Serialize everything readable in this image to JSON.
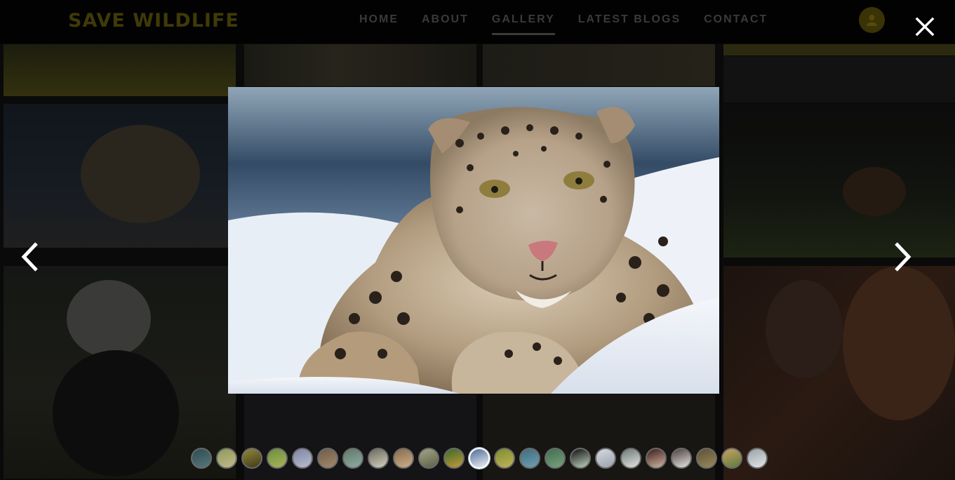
{
  "site": {
    "brand": "SAVE WILDLIFE",
    "nav": [
      "HOME",
      "ABOUT",
      "GALLERY",
      "LATEST BLOGS",
      "CONTACT"
    ],
    "active_nav": "GALLERY",
    "user_icon": "user-icon"
  },
  "lightbox": {
    "close_icon": "close-icon",
    "prev_icon": "chevron-left-icon",
    "next_icon": "chevron-right-icon",
    "image_subject": "snow leopard lying in snow",
    "active_index": 11,
    "thumbnails": [
      {
        "c1": "#2e4c52",
        "c2": "#56777a"
      },
      {
        "c1": "#8f9a5a",
        "c2": "#c2b98b"
      },
      {
        "c1": "#93873c",
        "c2": "#3f3a16"
      },
      {
        "c1": "#6e8f3a",
        "c2": "#a9b45a"
      },
      {
        "c1": "#7e86a6",
        "c2": "#b8bccf"
      },
      {
        "c1": "#6f5b4a",
        "c2": "#a38a6c"
      },
      {
        "c1": "#5f7a6c",
        "c2": "#8faaa0"
      },
      {
        "c1": "#6b6b5a",
        "c2": "#d2d0c0"
      },
      {
        "c1": "#8a6a4a",
        "c2": "#cbb08a"
      },
      {
        "c1": "#a3a587",
        "c2": "#5e6046"
      },
      {
        "c1": "#3a6a2c",
        "c2": "#c49a3a"
      },
      {
        "c1": "#4d6c9a",
        "c2": "#eef1f6"
      },
      {
        "c1": "#7d8d2e",
        "c2": "#c2b25a"
      },
      {
        "c1": "#3f6c80",
        "c2": "#6f9fb0"
      },
      {
        "c1": "#3f6f4f",
        "c2": "#7aa17f"
      },
      {
        "c1": "#111111",
        "c2": "#bdd3bd"
      },
      {
        "c1": "#d5d8de",
        "c2": "#9ba2ad"
      },
      {
        "c1": "#6e7a7a",
        "c2": "#e2e4e0"
      },
      {
        "c1": "#3a1c18",
        "c2": "#d3b5a3"
      },
      {
        "c1": "#4a4040",
        "c2": "#e8e4e0"
      },
      {
        "c1": "#5e5034",
        "c2": "#9a8a5e"
      },
      {
        "c1": "#c9a25f",
        "c2": "#5c7a3e"
      },
      {
        "c1": "#9aa3a8",
        "c2": "#e3e6e6"
      }
    ]
  }
}
